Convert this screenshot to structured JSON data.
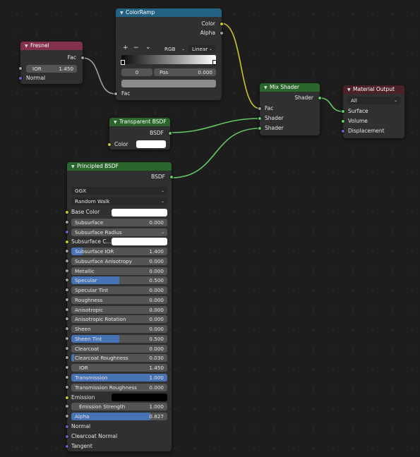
{
  "colors": {
    "header_input": "#83314a",
    "header_converter": "#246283",
    "header_shader": "#2a652b",
    "header_output": "#4b2127",
    "socket_float": "#a1a1a1",
    "socket_color": "#c7c729",
    "socket_vector": "#6363c7",
    "socket_shader": "#63c763",
    "wire_shader": "#63c763",
    "wire_float": "#a1a1a1",
    "wire_color": "#c7c729"
  },
  "fresnel": {
    "title": "Fresnel",
    "out_fac": "Fac",
    "ior_label": "IOR",
    "ior_value": "1.450",
    "normal": "Normal"
  },
  "colorramp": {
    "title": "ColorRamp",
    "out_color": "Color",
    "out_alpha": "Alpha",
    "add": "+",
    "remove": "−",
    "menu": "⌄",
    "mode": "RGB",
    "interp": "Linear",
    "index": "0",
    "pos_label": "Pos",
    "pos_value": "0.000",
    "in_fac": "Fac"
  },
  "transparent": {
    "title": "Transparent BSDF",
    "out": "BSDF",
    "color_label": "Color"
  },
  "mix": {
    "title": "Mix Shader",
    "out": "Shader",
    "in_fac": "Fac",
    "in_shader1": "Shader",
    "in_shader2": "Shader"
  },
  "output": {
    "title": "Material Output",
    "target": "All",
    "surface": "Surface",
    "volume": "Volume",
    "displacement": "Displacement"
  },
  "principled": {
    "title": "Principled BSDF",
    "out": "BSDF",
    "distribution": "GGX",
    "subsurface_method": "Random Walk",
    "base_color": "Base Color",
    "subsurface_color": "Subsurface C...",
    "subsurface_radius": "Subsurface Radius",
    "emission": "Emission",
    "normal": "Normal",
    "clearcoat_normal": "Clearcoat Normal",
    "tangent": "Tangent",
    "fields": [
      {
        "label": "Subsurface",
        "value": "0.000",
        "fill": 0
      },
      {
        "label": "Subsurface IOR",
        "value": "1.400",
        "fill": 0.12
      },
      {
        "label": "Subsurface Anisotropy",
        "value": "0.000",
        "fill": 0
      },
      {
        "label": "Metallic",
        "value": "0.000",
        "fill": 0
      },
      {
        "label": "Specular",
        "value": "0.500",
        "fill": 0.5
      },
      {
        "label": "Specular Tint",
        "value": "0.000",
        "fill": 0
      },
      {
        "label": "Roughness",
        "value": "0.000",
        "fill": 0
      },
      {
        "label": "Anisotropic",
        "value": "0.000",
        "fill": 0
      },
      {
        "label": "Anisotropic Rotation",
        "value": "0.000",
        "fill": 0
      },
      {
        "label": "Sheen",
        "value": "0.000",
        "fill": 0
      },
      {
        "label": "Sheen Tint",
        "value": "0.500",
        "fill": 0.5
      },
      {
        "label": "Clearcoat",
        "value": "0.000",
        "fill": 0
      },
      {
        "label": "Clearcoat Roughness",
        "value": "0.030",
        "fill": 0.03
      },
      {
        "label": "IOR",
        "value": "1.450",
        "fill": 0
      },
      {
        "label": "Transmission",
        "value": "1.000",
        "fill": 1
      },
      {
        "label": "Transmission Roughness",
        "value": "0.000",
        "fill": 0
      },
      {
        "label": "Emission Strength",
        "value": "1.000",
        "fill": 0
      },
      {
        "label": "Alpha",
        "value": "0.827",
        "fill": 0.827
      }
    ]
  }
}
